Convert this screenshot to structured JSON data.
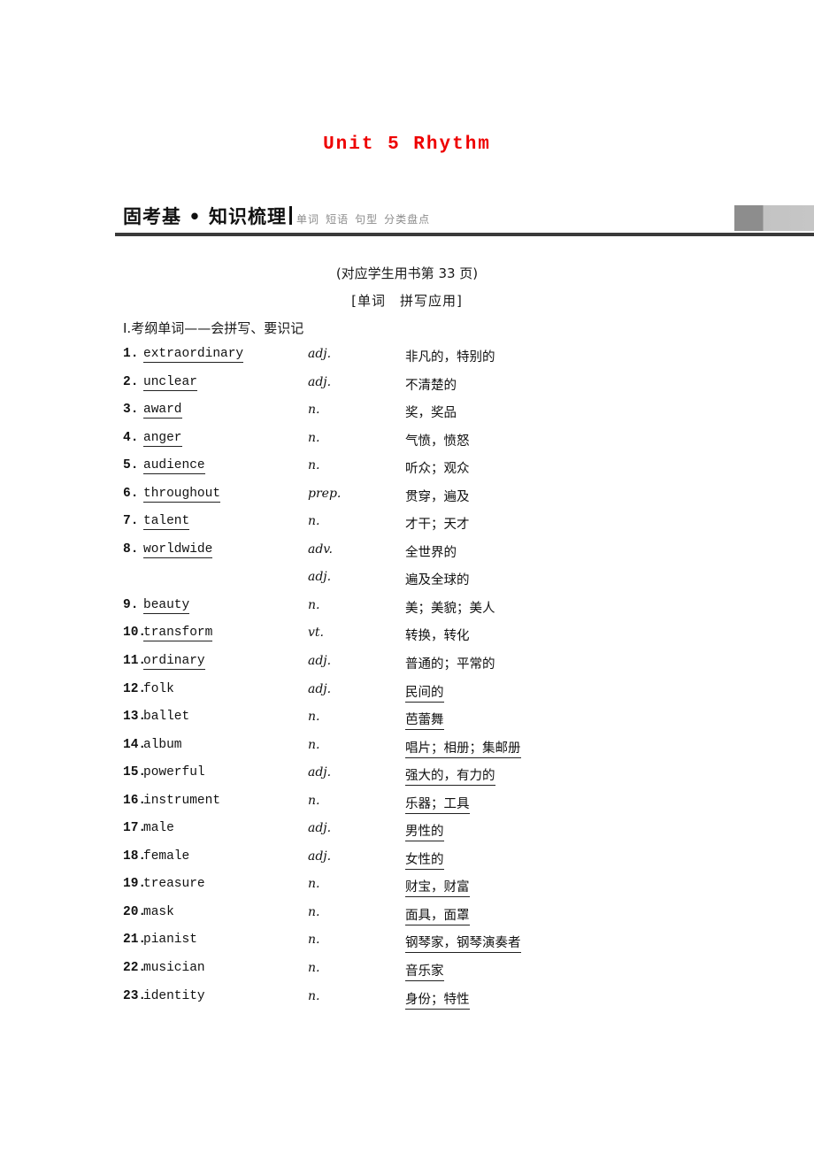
{
  "unit": {
    "title": "Unit 5  Rhythm",
    "title_color": "#ee0000"
  },
  "banner": {
    "title": "固考基 • 知识梳理",
    "tags": [
      "单词",
      "短语",
      "句型",
      "分类盘点"
    ],
    "rule_color": "#3a3a3a",
    "block_color_dark": "#8d8d8d",
    "block_color_light": "#c6c6c6"
  },
  "headings": {
    "reference_page": "(对应学生用书第 33 页)",
    "bracket_head": "[单词　拼写应用]",
    "roman_head": "Ⅰ.考纲单词——会拼写、要识记"
  },
  "words": [
    {
      "num": "1.",
      "word": "extraordinary",
      "word_underlined": true,
      "pos": "adj.",
      "meaning": "非凡的，特别的",
      "meaning_underlined": false
    },
    {
      "num": "2.",
      "word": "unclear",
      "word_underlined": true,
      "pos": "adj.",
      "meaning": "不清楚的",
      "meaning_underlined": false
    },
    {
      "num": "3.",
      "word": "award",
      "word_underlined": true,
      "pos": "n.",
      "meaning": "奖，奖品",
      "meaning_underlined": false
    },
    {
      "num": "4.",
      "word": "anger",
      "word_underlined": true,
      "pos": "n.",
      "meaning": "气愤，愤怒",
      "meaning_underlined": false
    },
    {
      "num": "5.",
      "word": "audience",
      "word_underlined": true,
      "pos": "n.",
      "meaning": "听众；观众",
      "meaning_underlined": false
    },
    {
      "num": "6.",
      "word": "throughout",
      "word_underlined": true,
      "pos": "prep.",
      "meaning": "贯穿，遍及",
      "meaning_underlined": false
    },
    {
      "num": "7.",
      "word": "talent",
      "word_underlined": true,
      "pos": "n.",
      "meaning": "才干；天才",
      "meaning_underlined": false
    },
    {
      "num": "8.",
      "word": "worldwide",
      "word_underlined": true,
      "pos": "adv.",
      "meaning": "全世界的",
      "meaning_underlined": false
    },
    {
      "num": "",
      "word": "",
      "word_underlined": false,
      "pos": "adj.",
      "meaning": "遍及全球的",
      "meaning_underlined": false
    },
    {
      "num": "9.",
      "word": "beauty",
      "word_underlined": true,
      "pos": "n.",
      "meaning": "美；美貌；美人",
      "meaning_underlined": false
    },
    {
      "num": "10.",
      "word": "transform",
      "word_underlined": true,
      "pos": "vt.",
      "meaning": "转换，转化",
      "meaning_underlined": false
    },
    {
      "num": "11.",
      "word": "ordinary",
      "word_underlined": true,
      "pos": "adj.",
      "meaning": "普通的；平常的",
      "meaning_underlined": false
    },
    {
      "num": "12.",
      "word": "folk",
      "word_underlined": false,
      "pos": "adj.",
      "meaning": "民间的",
      "meaning_underlined": true
    },
    {
      "num": "13.",
      "word": "ballet",
      "word_underlined": false,
      "pos": "n.",
      "meaning": "芭蕾舞",
      "meaning_underlined": true
    },
    {
      "num": "14.",
      "word": "album",
      "word_underlined": false,
      "pos": "n.",
      "meaning": "唱片；相册；集邮册",
      "meaning_underlined": true
    },
    {
      "num": "15.",
      "word": "powerful",
      "word_underlined": false,
      "pos": "adj.",
      "meaning": "强大的，有力的",
      "meaning_underlined": true
    },
    {
      "num": "16.",
      "word": "instrument",
      "word_underlined": false,
      "pos": "n.",
      "meaning": "乐器；工具",
      "meaning_underlined": true
    },
    {
      "num": "17.",
      "word": "male",
      "word_underlined": false,
      "pos": "adj.",
      "meaning": "男性的",
      "meaning_underlined": true
    },
    {
      "num": "18.",
      "word": "female",
      "word_underlined": false,
      "pos": "adj.",
      "meaning": "女性的",
      "meaning_underlined": true
    },
    {
      "num": "19.",
      "word": "treasure",
      "word_underlined": false,
      "pos": "n.",
      "meaning": "财宝，财富",
      "meaning_underlined": true
    },
    {
      "num": "20.",
      "word": "mask",
      "word_underlined": false,
      "pos": "n.",
      "meaning": "面具，面罩",
      "meaning_underlined": true
    },
    {
      "num": "21.",
      "word": "pianist",
      "word_underlined": false,
      "pos": "n.",
      "meaning": "钢琴家，钢琴演奏者",
      "meaning_underlined": true
    },
    {
      "num": "22.",
      "word": "musician",
      "word_underlined": false,
      "pos": "n.",
      "meaning": "音乐家",
      "meaning_underlined": true
    },
    {
      "num": "23.",
      "word": "identity",
      "word_underlined": false,
      "pos": "n.",
      "meaning": "身份；特性",
      "meaning_underlined": true
    }
  ]
}
